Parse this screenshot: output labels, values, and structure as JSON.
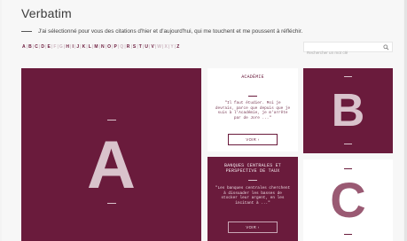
{
  "header": {
    "title": "Verbatim",
    "subtitle": "J'ai sélectionné pour vous des citations d'hier et d'aujourd'hui, qui me touchent et me poussent à réfléchir."
  },
  "alphabet": [
    {
      "letter": "A",
      "active": true
    },
    {
      "letter": "B",
      "active": true
    },
    {
      "letter": "C",
      "active": true
    },
    {
      "letter": "D",
      "active": true
    },
    {
      "letter": "E",
      "active": true
    },
    {
      "letter": "F",
      "active": false
    },
    {
      "letter": "G",
      "active": false
    },
    {
      "letter": "H",
      "active": true
    },
    {
      "letter": "I",
      "active": true
    },
    {
      "letter": "J",
      "active": true
    },
    {
      "letter": "K",
      "active": true
    },
    {
      "letter": "L",
      "active": true
    },
    {
      "letter": "M",
      "active": true
    },
    {
      "letter": "N",
      "active": true
    },
    {
      "letter": "O",
      "active": true
    },
    {
      "letter": "P",
      "active": true
    },
    {
      "letter": "Q",
      "active": false
    },
    {
      "letter": "R",
      "active": true
    },
    {
      "letter": "S",
      "active": true
    },
    {
      "letter": "T",
      "active": true
    },
    {
      "letter": "U",
      "active": true
    },
    {
      "letter": "V",
      "active": true
    },
    {
      "letter": "W",
      "active": false
    },
    {
      "letter": "X",
      "active": false
    },
    {
      "letter": "Y",
      "active": false
    },
    {
      "letter": "Z",
      "active": true
    }
  ],
  "search": {
    "placeholder": "Rechercher un mot clé",
    "icon": "search-icon"
  },
  "tiles": {
    "letter_a": "A",
    "letter_b": "B",
    "letter_c": "C",
    "card_academie": {
      "title": "ACADÉMIE",
      "quote": "\"Il faut étudier. Moi je devrais, parce que depuis que je suis à l'Académie, je m'arrête par de Jore ...\"",
      "button": "VOIR ›"
    },
    "card_banques": {
      "title_line1": "BANQUES CENTRALES ET",
      "title_line2": "PERSPECTIVE DE TAUX",
      "quote": "\"Les banques centrales cherchent à dissuader les basses de stocker leur argent, en les incitant à ...\"",
      "button": "VOIR ›"
    }
  },
  "colors": {
    "brand": "#6a1b3c",
    "letter_light": "#d9c3cc",
    "letter_dark": "#9a5a73"
  }
}
